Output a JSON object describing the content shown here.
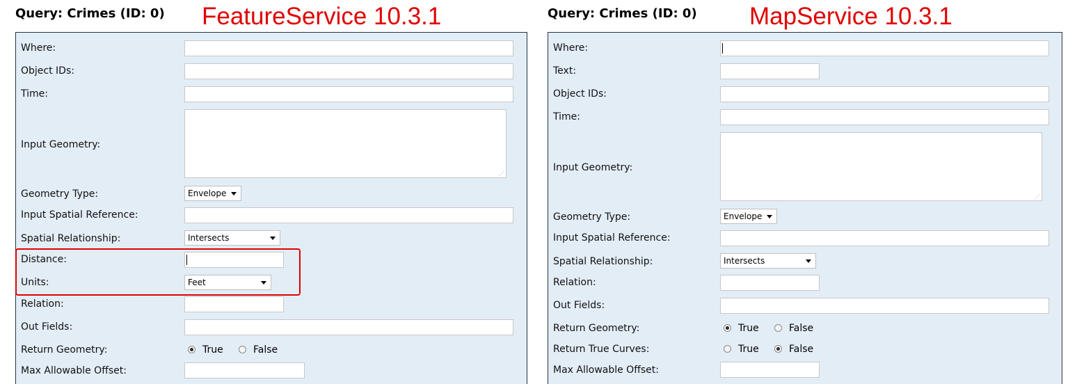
{
  "colors": {
    "panel_bg": "#e3edf6",
    "annotation_red": "#e00000",
    "panel_border": "#223344"
  },
  "left": {
    "title": "Query: Crimes (ID: 0)",
    "annotation": "FeatureService 10.3.1",
    "fields": {
      "where": {
        "label": "Where:",
        "value": ""
      },
      "object_ids": {
        "label": "Object IDs:",
        "value": ""
      },
      "time": {
        "label": "Time:",
        "value": ""
      },
      "input_geometry": {
        "label": "Input Geometry:",
        "value": ""
      },
      "geometry_type": {
        "label": "Geometry Type:",
        "selected": "Envelope"
      },
      "input_spatial_reference": {
        "label": "Input Spatial Reference:",
        "value": ""
      },
      "spatial_relationship": {
        "label": "Spatial Relationship:",
        "selected": "Intersects"
      },
      "distance": {
        "label": "Distance:",
        "value": ""
      },
      "units": {
        "label": "Units:",
        "selected": "Feet"
      },
      "relation": {
        "label": "Relation:",
        "value": ""
      },
      "out_fields": {
        "label": "Out Fields:",
        "value": ""
      },
      "return_geometry": {
        "label": "Return Geometry:",
        "true_label": "True",
        "false_label": "False",
        "selected": "True"
      },
      "max_allowable_offset": {
        "label": "Max Allowable Offset:",
        "value": ""
      }
    }
  },
  "right": {
    "title": "Query: Crimes (ID: 0)",
    "annotation": "MapService 10.3.1",
    "fields": {
      "where": {
        "label": "Where:",
        "value": ""
      },
      "text": {
        "label": "Text:",
        "value": ""
      },
      "object_ids": {
        "label": "Object IDs:",
        "value": ""
      },
      "time": {
        "label": "Time:",
        "value": ""
      },
      "input_geometry": {
        "label": "Input Geometry:",
        "value": ""
      },
      "geometry_type": {
        "label": "Geometry Type:",
        "selected": "Envelope"
      },
      "input_spatial_reference": {
        "label": "Input Spatial Reference:",
        "value": ""
      },
      "spatial_relationship": {
        "label": "Spatial Relationship:",
        "selected": "Intersects"
      },
      "relation": {
        "label": "Relation:",
        "value": ""
      },
      "out_fields": {
        "label": "Out Fields:",
        "value": ""
      },
      "return_geometry": {
        "label": "Return Geometry:",
        "true_label": "True",
        "false_label": "False",
        "selected": "True"
      },
      "return_true_curves": {
        "label": "Return True Curves:",
        "true_label": "True",
        "false_label": "False",
        "selected": "False"
      },
      "max_allowable_offset": {
        "label": "Max Allowable Offset:",
        "value": ""
      }
    }
  }
}
